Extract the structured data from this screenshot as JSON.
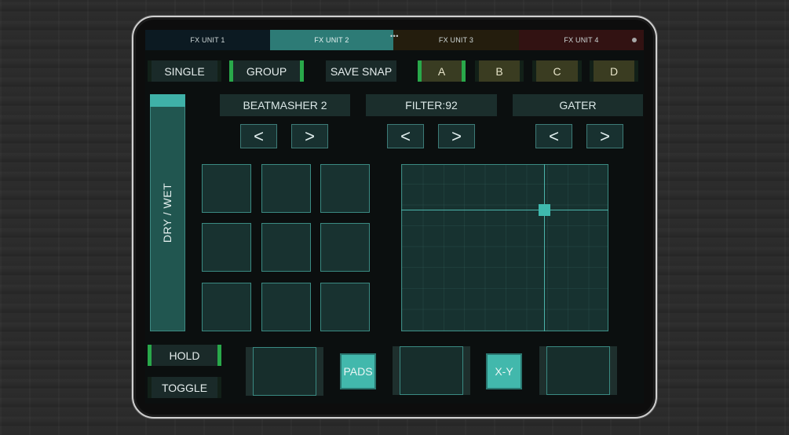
{
  "tabs": [
    {
      "label": "FX UNIT 1"
    },
    {
      "label": "FX UNIT 2"
    },
    {
      "label": "FX UNIT 3"
    },
    {
      "label": "FX UNIT 4"
    }
  ],
  "tab_indicator": "•••",
  "mode_buttons": {
    "single": "SINGLE",
    "group": "GROUP",
    "save_snap": "SAVE SNAP"
  },
  "snapshots": [
    "A",
    "B",
    "C",
    "D"
  ],
  "dry_wet": {
    "label": "DRY / WET"
  },
  "effects": [
    {
      "name": "BEATMASHER 2",
      "prev": "<",
      "next": ">"
    },
    {
      "name": "FILTER:92",
      "prev": "<",
      "next": ">"
    },
    {
      "name": "GATER",
      "prev": "<",
      "next": ">"
    }
  ],
  "bottom": {
    "hold": "HOLD",
    "toggle": "TOGGLE",
    "pads": "PADS",
    "xy": "X-Y"
  },
  "xy_pad": {
    "x_value": 0.69,
    "y_value": 0.73
  },
  "colors": {
    "accent": "#3fb1a8",
    "active_indicator": "#29a84a",
    "tab_active": "#2d7b76",
    "snapshot_bg": "#3a3c21"
  }
}
